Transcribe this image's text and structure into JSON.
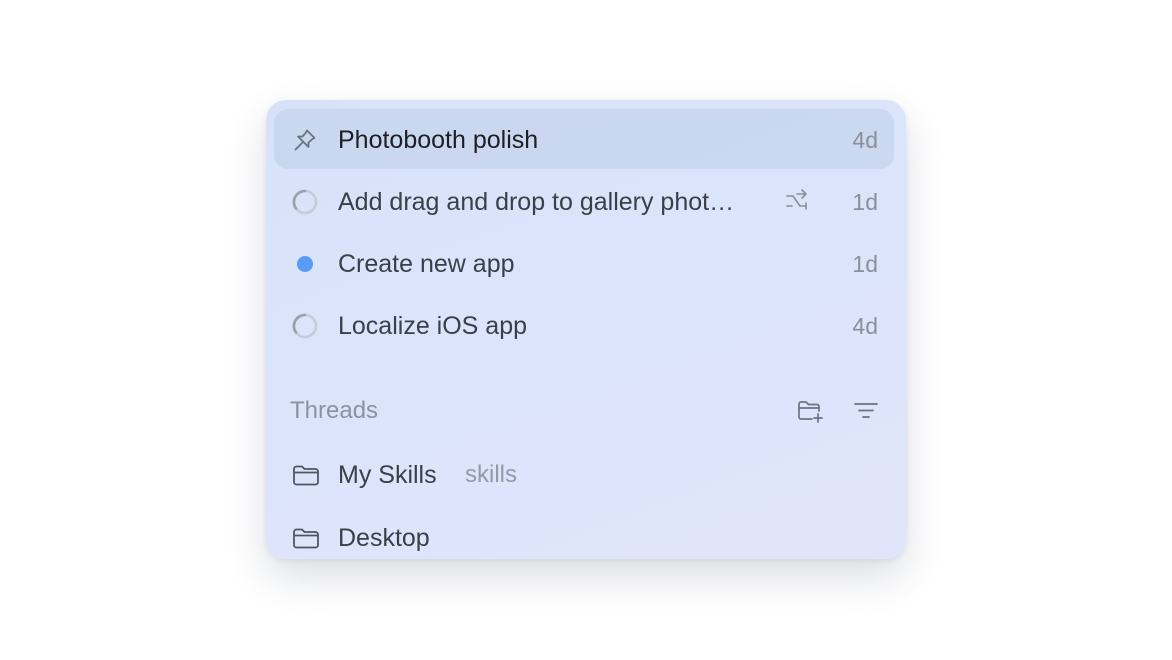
{
  "recent": [
    {
      "icon": "pin-icon",
      "title": "Photobooth polish",
      "age": "4d",
      "active": true
    },
    {
      "icon": "spinner-icon",
      "title": "Add drag and drop to gallery phot…",
      "age": "1d",
      "extra_icon": "handoff-icon"
    },
    {
      "icon": "unread-dot-icon",
      "title": "Create new app",
      "age": "1d"
    },
    {
      "icon": "spinner-icon",
      "title": "Localize iOS app",
      "age": "4d"
    }
  ],
  "threads": {
    "header": "Threads",
    "actions": [
      "new-folder-icon",
      "filter-icon"
    ],
    "folders": [
      {
        "icon": "folder-icon",
        "title": "My Skills",
        "tag": "skills"
      },
      {
        "icon": "folder-icon",
        "title": "Desktop",
        "tag": ""
      }
    ]
  },
  "colors": {
    "accent_dot": "#5a9bf5",
    "panel_bg": "#dbe4fb",
    "text": "#3a4048",
    "muted": "#8a9099"
  }
}
